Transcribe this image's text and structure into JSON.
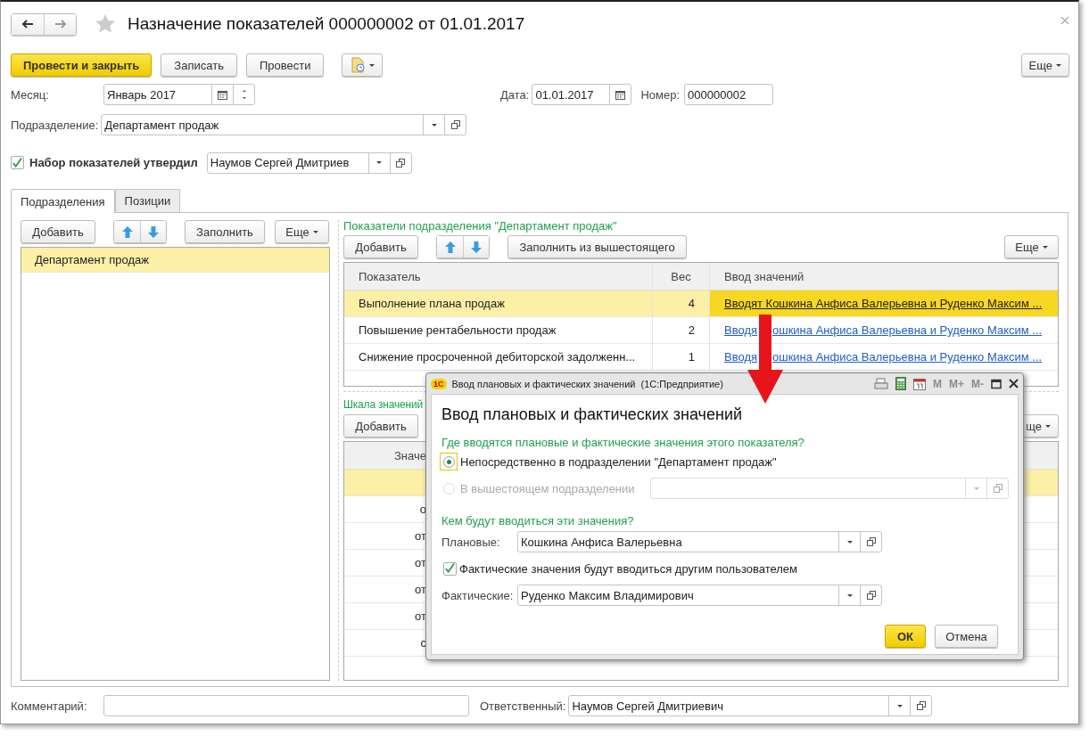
{
  "window": {
    "title": "Назначение показателей 000000002 от 01.01.2017",
    "favorite": false
  },
  "toolbar": {
    "buttons": [
      {
        "label": "Провести и закрыть",
        "kind": "primary"
      },
      {
        "label": "Записать",
        "kind": "normal"
      },
      {
        "label": "Провести",
        "kind": "normal"
      },
      {
        "kind": "report-menu"
      }
    ],
    "more": "Еще"
  },
  "month": {
    "label": "Месяц:",
    "value": "Январь 2017"
  },
  "date": {
    "label": "Дата:",
    "value": "01.01.2017"
  },
  "number": {
    "label": "Номер:",
    "value": "000000002"
  },
  "department": {
    "label": "Подразделение:",
    "value": "Департамент продаж"
  },
  "approved": {
    "label": "Набор показателей утвердил",
    "checked": true,
    "value": "Наумов Сергей Дмитриев"
  },
  "tabs": [
    {
      "label": "Подразделения",
      "selected": true
    },
    {
      "label": "Позиции",
      "selected": false
    }
  ],
  "departments_pane": {
    "add": "Добавить",
    "fill": "Заполнить",
    "more": "Еще",
    "items": [
      {
        "label": "Департамент продаж",
        "selected": true
      }
    ]
  },
  "indicators": {
    "title": "Показатели подразделения \"Департамент продаж\"",
    "add": "Добавить",
    "fill": "Заполнить из вышестоящего",
    "more": "Еще",
    "columns": [
      "Показатель",
      "Вес",
      "Ввод значений"
    ],
    "rows": [
      {
        "name": "Выполнение плана продаж",
        "weight": "4",
        "entry": "Вводят Кошкина Анфиса Валерьевна и Руденко Максим ...",
        "selected": true
      },
      {
        "name": "Повышение рентабельности продаж",
        "weight": "2",
        "entry": "Вводя",
        "entry_rest": "ошкина Анфиса Валерьевна и Руденко Максим ...",
        "selected": false
      },
      {
        "name": "Снижение просроченной дебиторской задолженн...",
        "weight": "1",
        "entry": "Вводя",
        "entry_rest": "ошкина Анфиса Валерьевна и Руденко Максим ...",
        "selected": false
      }
    ]
  },
  "scale": {
    "title": "Шкала значений",
    "add": "Добавить",
    "more": "ще",
    "columns": [
      "Значе"
    ],
    "rows": [
      {
        "selected": true
      },
      {
        "value": "о",
        "selected": false
      },
      {
        "value": "от",
        "selected": false
      },
      {
        "value": "от",
        "selected": false
      },
      {
        "value": "от",
        "selected": false
      },
      {
        "value": "от",
        "selected": false
      },
      {
        "value": "с",
        "selected": false
      }
    ]
  },
  "comment": {
    "label": "Комментарий:"
  },
  "responsible": {
    "label": "Ответственный:",
    "value": "Наумов Сергей Дмитриевич"
  },
  "dialog": {
    "window_title": "Ввод плановых и фактических значений  (1С:Предприятие)",
    "logo": "1С",
    "memory_buttons": [
      "M",
      "M+",
      "M-"
    ],
    "heading": "Ввод плановых и фактических значений",
    "question_where": "Где вводятся плановые и фактические значения этого показателя?",
    "options": [
      {
        "label": "Непосредственно в подразделении \"Департамент продаж\"",
        "selected": true,
        "disabled": false,
        "kind": "plain"
      },
      {
        "label": "В вышестоящем подразделении",
        "selected": false,
        "disabled": true,
        "kind": "with-field"
      }
    ],
    "question_who": "Кем будут вводиться эти значения?",
    "planned": {
      "label": "Плановые:",
      "value": "Кошкина Анфиса Валерьевна"
    },
    "other_user": {
      "label": "Фактические значения будут вводиться другим пользователем",
      "checked": true
    },
    "actual": {
      "label": "Фактические:",
      "value": "Руденко Максим Владимирович"
    },
    "ok": "ОК",
    "cancel": "Отмена"
  }
}
